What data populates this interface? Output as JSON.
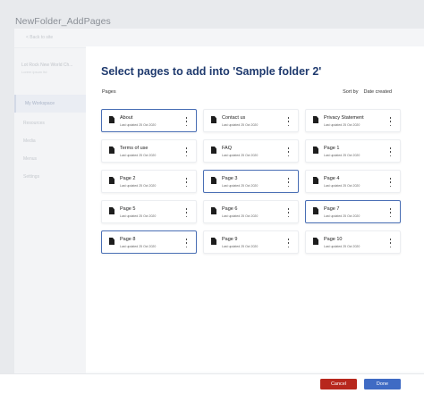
{
  "window_title": "NewFolder_AddPages",
  "topbar": {
    "back_label": "< Back to site"
  },
  "sidebar": {
    "site_name": "Lot Rock New World Ch...",
    "site_sub": "Lorem ipsum ltd",
    "items": [
      {
        "label": "My Workspace",
        "active": true
      },
      {
        "label": "Resources"
      },
      {
        "label": "Media"
      },
      {
        "label": "Menus"
      },
      {
        "label": "Settings"
      }
    ]
  },
  "dialog": {
    "heading": "Select pages to add into 'Sample folder 2'",
    "pages_label": "Pages",
    "sort_by_label": "Sort by",
    "sort_value": "Date created"
  },
  "cards": [
    {
      "title": "About",
      "date": "Last updated 25 Oct 2020",
      "selected": true
    },
    {
      "title": "Contact us",
      "date": "Last updated 25 Oct 2020",
      "selected": false
    },
    {
      "title": "Privacy Statement",
      "date": "Last updated 25 Oct 2020",
      "selected": false
    },
    {
      "title": "Terms of use",
      "date": "Last updated 25 Oct 2020",
      "selected": false
    },
    {
      "title": "FAQ",
      "date": "Last updated 25 Oct 2020",
      "selected": false
    },
    {
      "title": "Page 1",
      "date": "Last updated 25 Oct 2020",
      "selected": false
    },
    {
      "title": "Page 2",
      "date": "Last updated 25 Oct 2020",
      "selected": false
    },
    {
      "title": "Page 3",
      "date": "Last updated 25 Oct 2020",
      "selected": true
    },
    {
      "title": "Page 4",
      "date": "Last updated 25 Oct 2020",
      "selected": false
    },
    {
      "title": "Page 5",
      "date": "Last updated 25 Oct 2020",
      "selected": false
    },
    {
      "title": "Page 6",
      "date": "Last updated 25 Oct 2020",
      "selected": false
    },
    {
      "title": "Page 7",
      "date": "Last updated 25 Oct 2020",
      "selected": true
    },
    {
      "title": "Page 8",
      "date": "Last updated 25 Oct 2020",
      "selected": true
    },
    {
      "title": "Page 9",
      "date": "Last updated 25 Oct 2020",
      "selected": false
    },
    {
      "title": "Page 10",
      "date": "Last updated 25 Oct 2020",
      "selected": false
    }
  ],
  "footer": {
    "cancel_label": "Cancel",
    "done_label": "Done"
  },
  "colors": {
    "heading": "#1f3a6e",
    "selected_border": "#4a6fb5",
    "cancel": "#b7271d",
    "done": "#3f6bc4"
  }
}
